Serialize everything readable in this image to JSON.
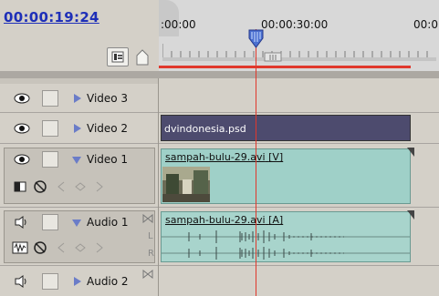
{
  "timecode": "00:00:19:24",
  "ruler": {
    "t0": ":00:00",
    "t30": "00:00:30:00",
    "t60": "00:0"
  },
  "tracks": {
    "video3": {
      "label": "Video 3"
    },
    "video2": {
      "label": "Video 2",
      "clip": "dvindonesia.psd"
    },
    "video1": {
      "label": "Video 1",
      "clip": "sampah-bulu-29.avi",
      "clip_suffix": "[V]"
    },
    "audio1": {
      "label": "Audio 1",
      "clip": "sampah-bulu-29.avi",
      "clip_suffix": "[A]",
      "ch_l": "L",
      "ch_r": "R"
    },
    "audio2": {
      "label": "Audio 2"
    }
  },
  "colors": {
    "timecode": "#1e2fb8",
    "playhead": "#e0382c",
    "clip_still": "#4d4b6e",
    "clip_video": "#9fd0c8",
    "clip_audio": "#a8d4cc"
  }
}
